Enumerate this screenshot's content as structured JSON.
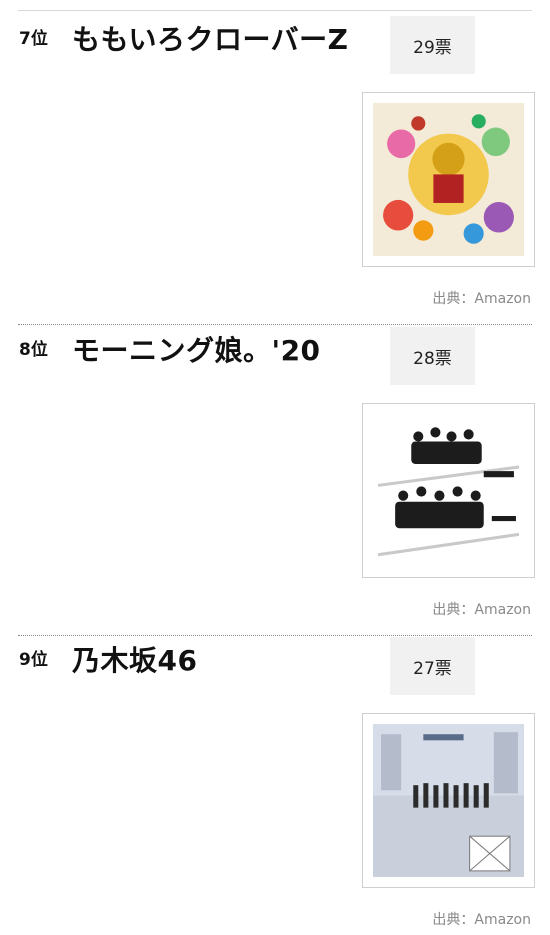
{
  "entries": [
    {
      "rank": "7位",
      "name": "ももいろクローバーZ",
      "votes": "29票",
      "credit": "出典：Amazon",
      "cover": "momoclo-album-cover"
    },
    {
      "rank": "8位",
      "name": "モーニング娘。'20",
      "votes": "28票",
      "credit": "出典：Amazon",
      "cover": "morning-musume-album-cover"
    },
    {
      "rank": "9位",
      "name": "乃木坂46",
      "votes": "27票",
      "credit": "出典：Amazon",
      "cover": "nogizaka-album-cover"
    }
  ]
}
